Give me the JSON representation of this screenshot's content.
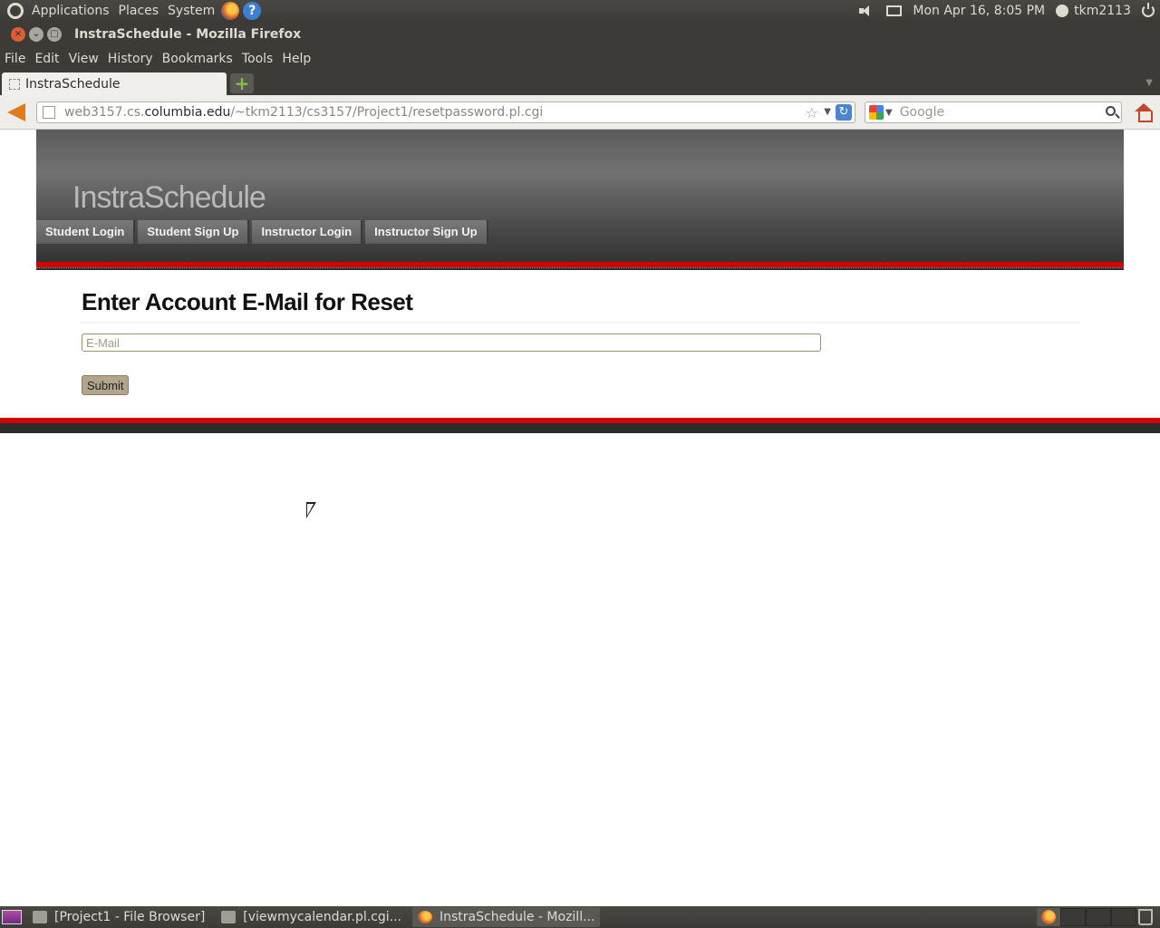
{
  "top_panel": {
    "menus": [
      "Applications",
      "Places",
      "System"
    ],
    "datetime": "Mon Apr 16,  8:05 PM",
    "user": "tkm2113"
  },
  "window": {
    "title": "InstraSchedule - Mozilla Firefox"
  },
  "menubar": {
    "items": [
      "File",
      "Edit",
      "View",
      "History",
      "Bookmarks",
      "Tools",
      "Help"
    ]
  },
  "tabs": [
    {
      "label": "InstraSchedule"
    }
  ],
  "navbar": {
    "url_prefix": "web3157.cs.",
    "url_host": "columbia.edu",
    "url_path": "/~tkm2113/cs3157/Project1/resetpassword.pl.cgi",
    "search_placeholder": "Google"
  },
  "site": {
    "title": "InstraSchedule",
    "nav": [
      "Student Login",
      "Student Sign Up",
      "Instructor Login",
      "Instructor Sign Up"
    ]
  },
  "form": {
    "heading": "Enter Account E-Mail for Reset",
    "email_placeholder": "E-Mail",
    "email_value": "",
    "submit_label": "Submit"
  },
  "taskbar": {
    "tasks": [
      {
        "label": "[Project1 - File Browser]",
        "icon": "folder-icon"
      },
      {
        "label": "[viewmycalendar.pl.cgi...",
        "icon": "text-editor-icon"
      },
      {
        "label": "InstraSchedule - Mozill...",
        "icon": "firefox-icon"
      }
    ]
  },
  "colors": {
    "panel": "#3c3b37",
    "accent_red": "#d40000",
    "submit_bg": "#b3a48c"
  }
}
